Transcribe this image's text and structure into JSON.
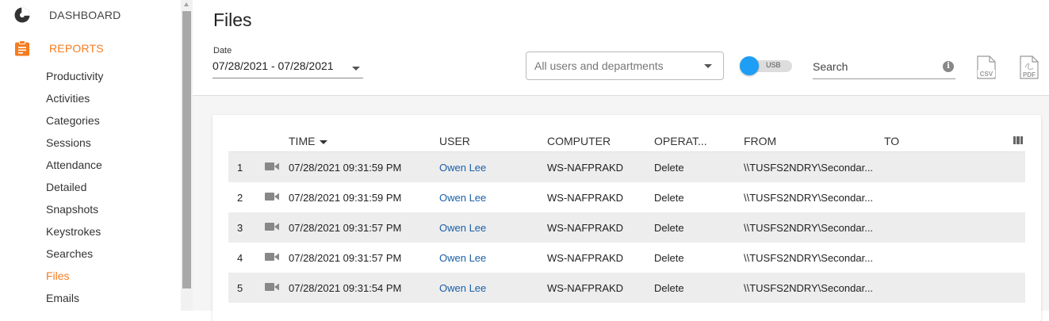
{
  "sidebar": {
    "dashboard_label": "DASHBOARD",
    "reports_label": "REPORTS",
    "items": [
      {
        "label": "Productivity"
      },
      {
        "label": "Activities"
      },
      {
        "label": "Categories"
      },
      {
        "label": "Sessions"
      },
      {
        "label": "Attendance"
      },
      {
        "label": "Detailed"
      },
      {
        "label": "Snapshots"
      },
      {
        "label": "Keystrokes"
      },
      {
        "label": "Searches"
      },
      {
        "label": "Files"
      },
      {
        "label": "Emails"
      }
    ],
    "active_item": "Files",
    "accent_color": "#f57c1f"
  },
  "header": {
    "title": "Files",
    "date_label": "Date",
    "date_value": "07/28/2021 - 07/28/2021",
    "user_select_placeholder": "All users and departments",
    "toggle_label": "USB",
    "search_placeholder": "Search",
    "info_icon_text": "i",
    "csv_label": "CSV",
    "pdf_label": "PDF"
  },
  "table": {
    "columns": {
      "time": "TIME",
      "user": "USER",
      "computer": "COMPUTER",
      "operation": "OPERAT...",
      "from": "FROM",
      "to": "TO"
    },
    "rows": [
      {
        "num": "1",
        "time": "07/28/2021 09:31:59 PM",
        "user": "Owen Lee",
        "computer": "WS-NAFPRAKD",
        "operation": "Delete",
        "from": "\\\\TUSFS2NDRY\\Secondar...",
        "to": ""
      },
      {
        "num": "2",
        "time": "07/28/2021 09:31:59 PM",
        "user": "Owen Lee",
        "computer": "WS-NAFPRAKD",
        "operation": "Delete",
        "from": "\\\\TUSFS2NDRY\\Secondar...",
        "to": ""
      },
      {
        "num": "3",
        "time": "07/28/2021 09:31:57 PM",
        "user": "Owen Lee",
        "computer": "WS-NAFPRAKD",
        "operation": "Delete",
        "from": "\\\\TUSFS2NDRY\\Secondar...",
        "to": ""
      },
      {
        "num": "4",
        "time": "07/28/2021 09:31:57 PM",
        "user": "Owen Lee",
        "computer": "WS-NAFPRAKD",
        "operation": "Delete",
        "from": "\\\\TUSFS2NDRY\\Secondar...",
        "to": ""
      },
      {
        "num": "5",
        "time": "07/28/2021 09:31:54 PM",
        "user": "Owen Lee",
        "computer": "WS-NAFPRAKD",
        "operation": "Delete",
        "from": "\\\\TUSFS2NDRY\\Secondar...",
        "to": ""
      }
    ]
  }
}
